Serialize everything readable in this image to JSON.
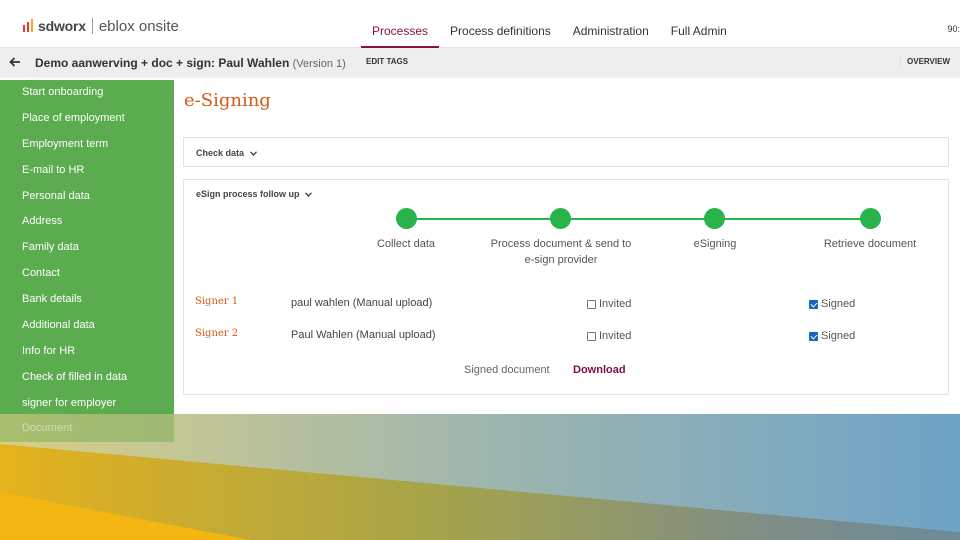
{
  "header": {
    "brand": "sdworx",
    "product": "eblox onsite",
    "nav": [
      "Processes",
      "Process definitions",
      "Administration",
      "Full Admin"
    ],
    "active_nav": "Processes",
    "user_chip": "90:",
    "accent": "#8a1538"
  },
  "process": {
    "title": "Demo aanwerving + doc + sign: Paul Wahlen",
    "version": "(Version 1)",
    "edit_tags": "EDIT TAGS",
    "overview": "OVERVIEW"
  },
  "sidebar": {
    "color": "#5aac4e",
    "items": [
      "Start onboarding",
      "Place of employment",
      "Employment term",
      "E-mail to HR",
      "Personal data",
      "Address",
      "Family data",
      "Contact",
      "Bank details",
      "Additional data",
      "Info for HR",
      "Check of filled in data",
      "signer for employer"
    ],
    "faded_item": "Document"
  },
  "main": {
    "title": "e-Signing",
    "title_color": "#d45a1a",
    "check_data": "Check data",
    "follow_up": "eSign process follow up",
    "steps": [
      {
        "line1": "Collect data",
        "line2": ""
      },
      {
        "line1": "Process document & send to",
        "line2": "e-sign provider"
      },
      {
        "line1": "eSigning",
        "line2": ""
      },
      {
        "line1": "Retrieve document",
        "line2": ""
      }
    ],
    "step_color": "#28b34b",
    "signers": [
      {
        "label": "Signer 1",
        "name": "paul wahlen (Manual upload)",
        "invited_label": "Invited",
        "invited": false,
        "signed_label": "Signed",
        "signed": true
      },
      {
        "label": "Signer 2",
        "name": "Paul Wahlen (Manual upload)",
        "invited_label": "Invited",
        "invited": false,
        "signed_label": "Signed",
        "signed": true
      }
    ],
    "signed_document": "Signed document",
    "download": "Download"
  }
}
